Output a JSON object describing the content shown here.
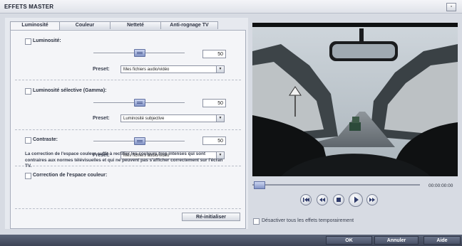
{
  "window": {
    "title": "EFFETS MASTER",
    "close_icon": "▫"
  },
  "tabs": [
    {
      "label": "Luminosité",
      "active": true
    },
    {
      "label": "Couleur",
      "active": false
    },
    {
      "label": "Netteté",
      "active": false
    },
    {
      "label": "Anti-rognage TV",
      "active": false
    }
  ],
  "luminosite": {
    "label": "Luminosité:",
    "value": "50",
    "slider_level": 0.5,
    "preset_label": "Preset:",
    "preset_value": "Mes fichiers audio/vidéo"
  },
  "gamma": {
    "label": "Luminosité sélective (Gamma):",
    "value": "50",
    "slider_level": 0.5,
    "preset_label": "Preset:",
    "preset_value": "Luminosité subjective"
  },
  "contraste": {
    "label": "Contraste:",
    "value": "50",
    "slider_level": 0.5,
    "preset_label": "Preset:",
    "preset_value": "Mes fichiers audio/vidéo"
  },
  "correction": {
    "label": "Correction de l'espace couleur:",
    "description": "La correction de l'espace couleur suffit à rectifier les couleurs trop intenses qui sont contraires aux normes télévisuelles et qui ne peuvent pas s'afficher correctement sur l'écran TV."
  },
  "reset_button": "Ré-initialiser",
  "player": {
    "timecode": "00:00:00:00",
    "position": 0
  },
  "disable_effects_label": "Désactiver tous les effets temporairement",
  "footer": {
    "ok": "OK",
    "cancel": "Annuler",
    "help": "Aide"
  },
  "colors": {
    "footer": "#4a5268",
    "accent": "#8394c6",
    "panel": "#f4f5f8"
  }
}
